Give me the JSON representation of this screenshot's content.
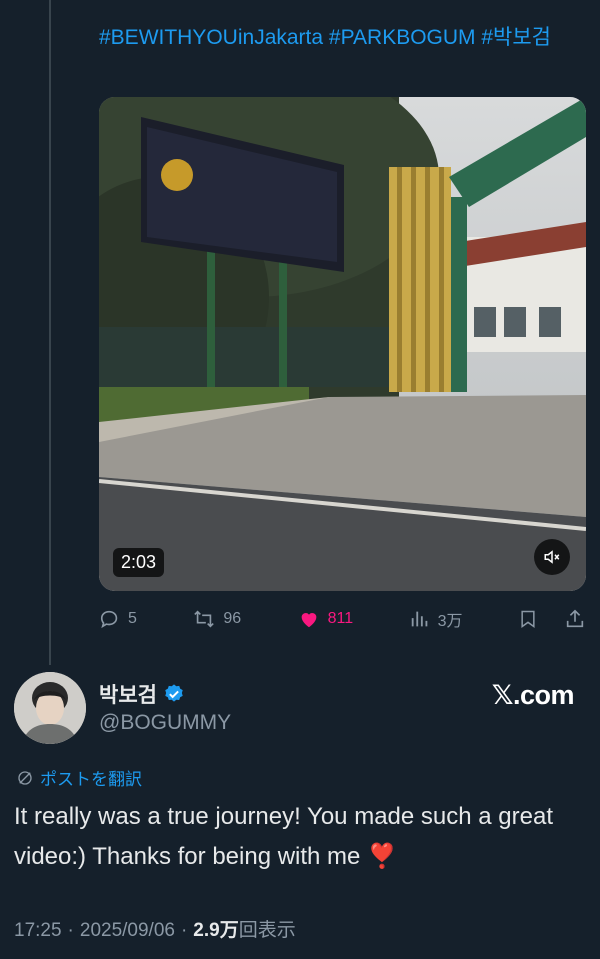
{
  "tweet_quoted": {
    "hashtags": "#BEWITHYOUinJakarta #PARKBOGUM #박보검",
    "video": {
      "duration": "2:03",
      "muted": true
    },
    "actions": {
      "replies": "5",
      "retweets": "96",
      "likes": "811",
      "views": "3万"
    }
  },
  "reply": {
    "display_name": "박보검",
    "verified": true,
    "handle": "@BOGUMMY",
    "watermark": "𝕏.com",
    "translate_label": "ポストを翻訳",
    "text": "It really was a true journey! You made such a great video:) Thanks for being with me ❣️",
    "time": "17:25",
    "date": "2025/09/06",
    "views_count": "2.9万",
    "views_label": "回表示",
    "separator": "·"
  },
  "colors": {
    "background": "#15202b",
    "link": "#1d9bf0",
    "like": "#f91880",
    "muted_text": "#8b98a5",
    "verified": "#1d9bf0"
  },
  "icons": [
    "reply-icon",
    "retweet-icon",
    "heart-icon",
    "views-icon",
    "bookmark-icon",
    "share-icon",
    "verified-badge-icon",
    "translate-globe-icon",
    "mute-icon"
  ]
}
